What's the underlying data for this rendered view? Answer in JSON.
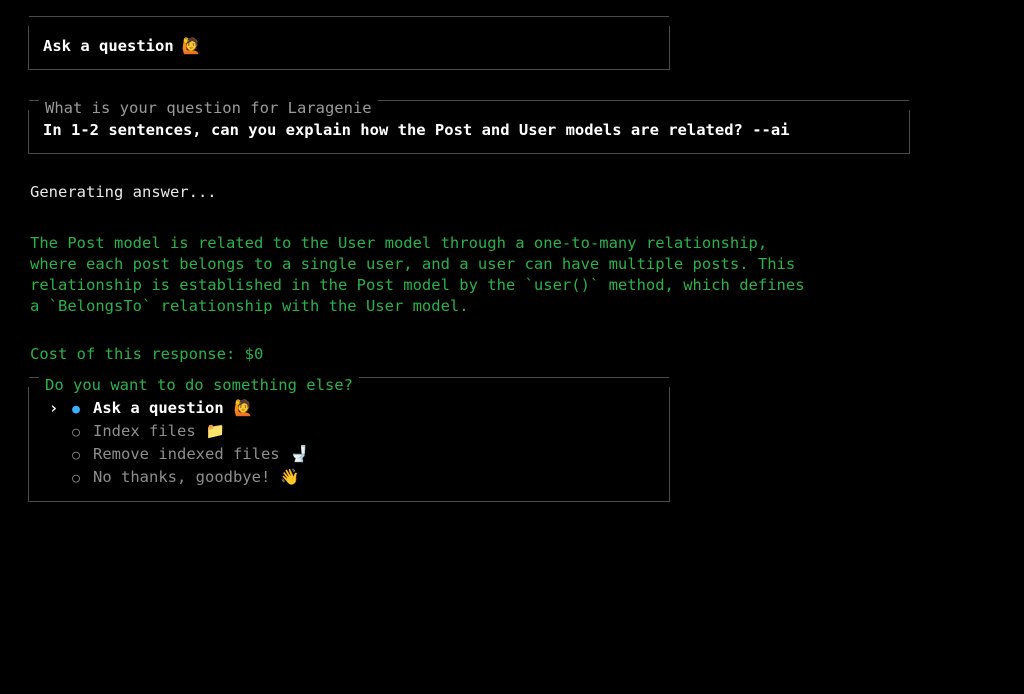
{
  "top_panel": {
    "title": "Ask a question",
    "title_emoji": "🙋"
  },
  "question_panel": {
    "prompt_label": "What is your question for Laragenie",
    "entered_text": "In 1-2 sentences, can you explain how the Post and User models are related? --ai"
  },
  "status_line": "Generating answer...",
  "answer_text": "The Post model is related to the User model through a one-to-many relationship, where each post belongs to a single user, and a user can have multiple posts. This relationship is established in the Post model by the `user()` method, which defines a `BelongsTo` relationship with the User model.",
  "cost_line": "Cost of this response: $0",
  "menu": {
    "prompt_label": "Do you want to do something else?",
    "items": [
      {
        "label": "Ask a question",
        "emoji": "🙋",
        "selected": true
      },
      {
        "label": "Index files",
        "emoji": "📁",
        "selected": false
      },
      {
        "label": "Remove indexed files",
        "emoji": "🚽",
        "selected": false
      },
      {
        "label": "No thanks, goodbye!",
        "emoji": "👋",
        "selected": false
      }
    ]
  }
}
